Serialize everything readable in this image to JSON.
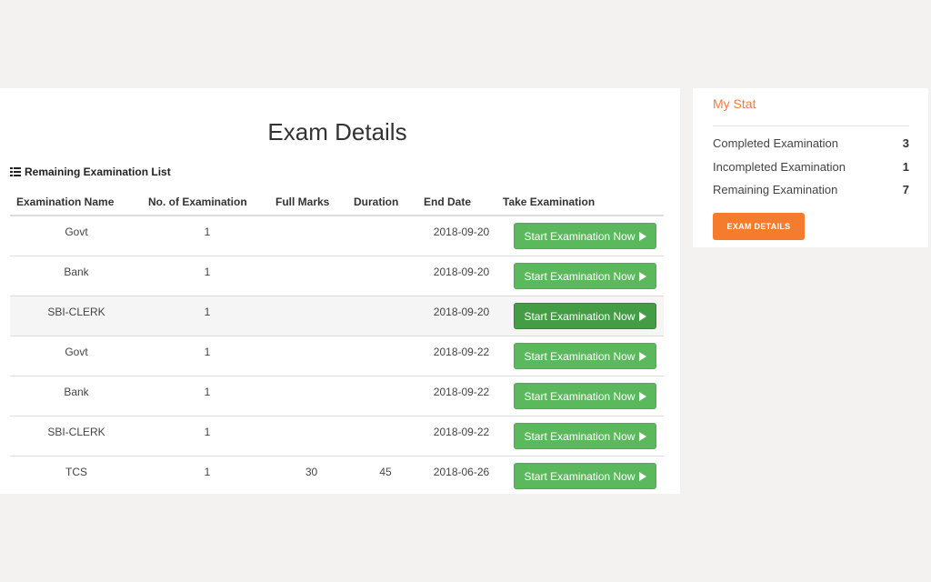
{
  "page": {
    "title": "Exam Details"
  },
  "list": {
    "heading": "Remaining Examination List",
    "columns": [
      "Examination Name",
      "No. of Examination",
      "Full Marks",
      "Duration",
      "End Date",
      "Take Examination"
    ],
    "rows": [
      {
        "name": "Govt",
        "count": "1",
        "full_marks": "",
        "duration": "",
        "end_date": "2018-09-20",
        "action": "Start Examination Now"
      },
      {
        "name": "Bank",
        "count": "1",
        "full_marks": "",
        "duration": "",
        "end_date": "2018-09-20",
        "action": "Start Examination Now"
      },
      {
        "name": "SBI-CLERK",
        "count": "1",
        "full_marks": "",
        "duration": "",
        "end_date": "2018-09-20",
        "action": "Start Examination Now"
      },
      {
        "name": "Govt",
        "count": "1",
        "full_marks": "",
        "duration": "",
        "end_date": "2018-09-22",
        "action": "Start Examination Now"
      },
      {
        "name": "Bank",
        "count": "1",
        "full_marks": "",
        "duration": "",
        "end_date": "2018-09-22",
        "action": "Start Examination Now"
      },
      {
        "name": "SBI-CLERK",
        "count": "1",
        "full_marks": "",
        "duration": "",
        "end_date": "2018-09-22",
        "action": "Start Examination Now"
      },
      {
        "name": "TCS",
        "count": "1",
        "full_marks": "30",
        "duration": "45",
        "end_date": "2018-06-26",
        "action": "Start Examination Now"
      }
    ]
  },
  "stat": {
    "title": "My Stat",
    "items": [
      {
        "label": "Completed Examination",
        "value": "3"
      },
      {
        "label": "Incompleted Examination",
        "value": "1"
      },
      {
        "label": "Remaining Examination",
        "value": "7"
      }
    ],
    "button_label": "EXAM DETAILS"
  },
  "colors": {
    "accent": "#f47c2c",
    "success": "#5cb85c"
  },
  "icons": {
    "list": "list-icon",
    "play": "play-icon"
  }
}
